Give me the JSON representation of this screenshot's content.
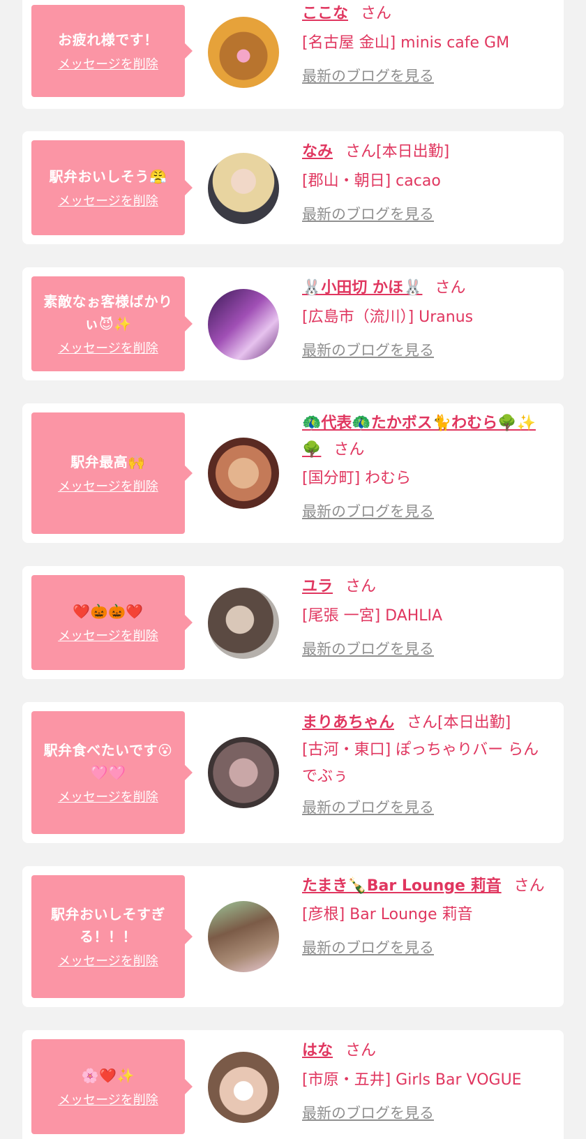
{
  "messages": [
    {
      "bubble": "お疲れ様です！",
      "delete_label": "メッセージを削除",
      "name": "ここな",
      "honorific": "さん",
      "shop": "[名古屋 金山] minis cafe GM",
      "blog_label": "最新のブログを見る"
    },
    {
      "bubble": "駅弁おいしそう😤",
      "delete_label": "メッセージを削除",
      "name": "なみ",
      "honorific": "さん[本日出勤]",
      "shop": "[郡山・朝日] cacao",
      "blog_label": "最新のブログを見る"
    },
    {
      "bubble": "素敵なぉ客様ばかりぃ😈✨",
      "delete_label": "メッセージを削除",
      "name": "🐰小田切 かほ🐰",
      "honorific": "さん",
      "shop": "[広島市（流川）] Uranus",
      "blog_label": "最新のブログを見る"
    },
    {
      "bubble": "駅弁最高🙌",
      "delete_label": "メッセージを削除",
      "name": "🦚代表🦚たかボス🐈わむら🌳✨🌳",
      "honorific": "さん",
      "shop": "[国分町] わむら",
      "blog_label": "最新のブログを見る"
    },
    {
      "bubble": "❤️🎃🎃❤️",
      "delete_label": "メッセージを削除",
      "name": "ユラ",
      "honorific": "さん",
      "shop": "[尾張 一宮] DAHLIA",
      "blog_label": "最新のブログを見る"
    },
    {
      "bubble": "駅弁食べたいです😮🩷🩷",
      "delete_label": "メッセージを削除",
      "name": "まりあちゃん",
      "honorific": "さん[本日出勤]",
      "shop": "[古河・東口] ぽっちゃりバー らんでぶぅ",
      "blog_label": "最新のブログを見る"
    },
    {
      "bubble": "駅弁おいしそすぎる！！！",
      "delete_label": "メッセージを削除",
      "name": "たまき🍾Bar Lounge 莉音",
      "honorific": "さん",
      "shop": "[彦根] Bar Lounge 莉音",
      "blog_label": "最新のブログを見る"
    },
    {
      "bubble": "🌸❤️✨",
      "delete_label": "メッセージを削除",
      "name": "はな",
      "honorific": "さん",
      "shop": "[市原・五井] Girls Bar VOGUE",
      "blog_label": "最新のブログを見る"
    }
  ],
  "colors": {
    "accent": "#e0365f",
    "bubble": "#fb95a5",
    "link_gray": "#8f8f8f",
    "page_bg": "#f2f2f2"
  }
}
